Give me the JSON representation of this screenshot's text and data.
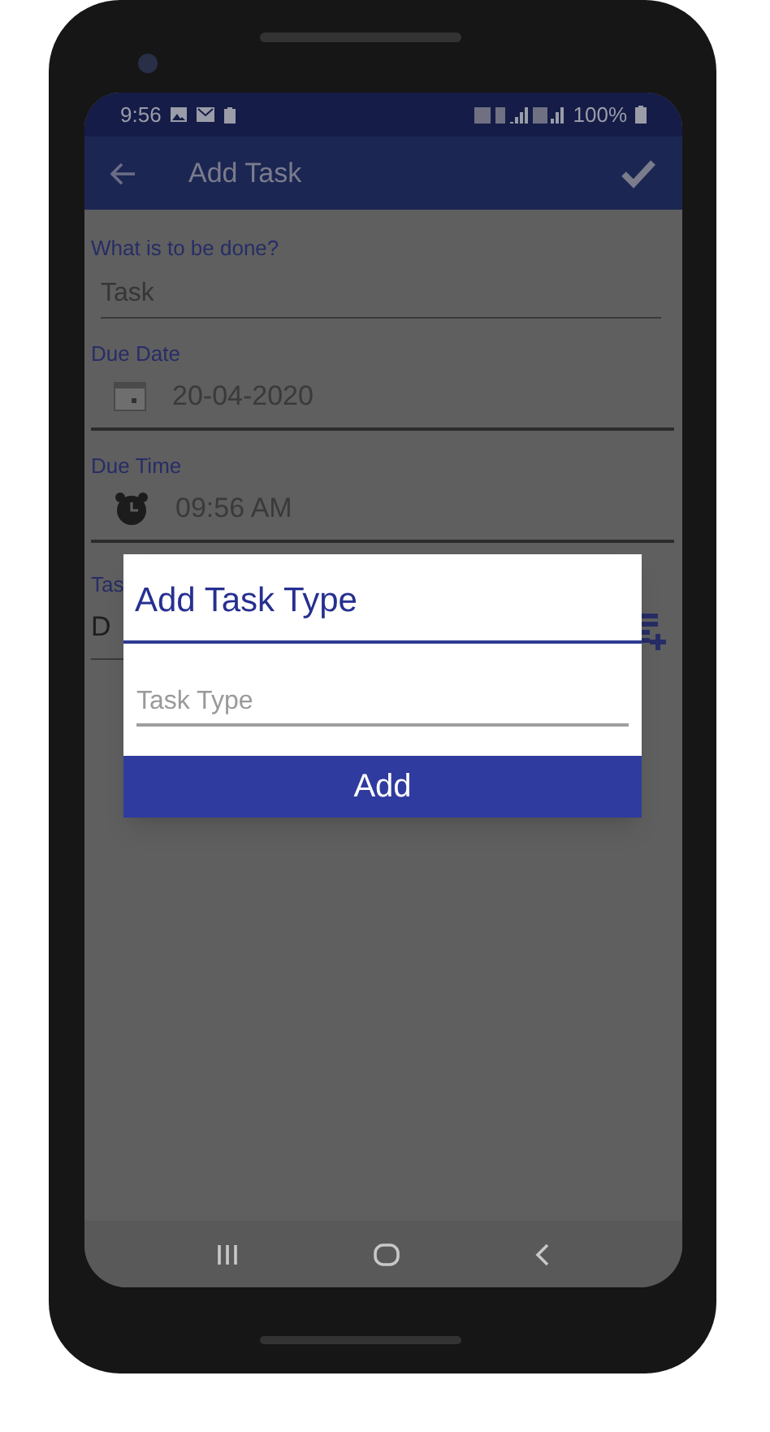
{
  "status_bar": {
    "time": "9:56",
    "battery": "100%"
  },
  "app_bar": {
    "title": "Add Task"
  },
  "form": {
    "fields": [
      {
        "kind": "text",
        "label": "What is to be done?",
        "placeholder": "Task"
      },
      {
        "kind": "date",
        "label": "Due Date",
        "value": "20-04-2020"
      },
      {
        "kind": "time",
        "label": "Due Time",
        "value": "09:56 AM"
      },
      {
        "kind": "select",
        "label": "Tas",
        "value": "D"
      }
    ]
  },
  "dialog": {
    "title": "Add Task Type",
    "placeholder": "Task Type",
    "button": "Add"
  }
}
